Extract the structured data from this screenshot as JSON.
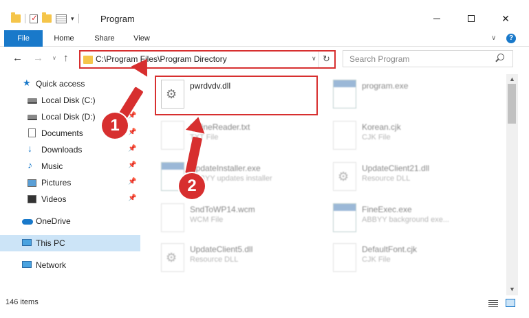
{
  "window": {
    "title": "Program",
    "controls": {
      "minimize": "minimize",
      "maximize": "maximize",
      "close": "close"
    }
  },
  "ribbon": {
    "tabs": [
      "File",
      "Home",
      "Share",
      "View"
    ],
    "help": "?"
  },
  "nav": {
    "address": "C:\\Program Files\\Program Directory",
    "search_placeholder": "Search Program"
  },
  "sidebar": {
    "items": [
      {
        "label": "Quick access",
        "icon": "star-icon",
        "pinned": false
      },
      {
        "label": "Local Disk (C:)",
        "icon": "drive-icon",
        "pinned": true
      },
      {
        "label": "Local Disk (D:)",
        "icon": "drive-icon",
        "pinned": true
      },
      {
        "label": "Documents",
        "icon": "documents-icon",
        "pinned": true
      },
      {
        "label": "Downloads",
        "icon": "download-icon",
        "pinned": true
      },
      {
        "label": "Music",
        "icon": "music-icon",
        "pinned": true
      },
      {
        "label": "Pictures",
        "icon": "pictures-icon",
        "pinned": true
      },
      {
        "label": "Videos",
        "icon": "videos-icon",
        "pinned": true
      },
      {
        "label": "OneDrive",
        "icon": "cloud-icon",
        "pinned": false
      },
      {
        "label": "This PC",
        "icon": "computer-icon",
        "pinned": false,
        "selected": true
      },
      {
        "label": "Network",
        "icon": "network-icon",
        "pinned": false
      }
    ]
  },
  "files": [
    {
      "name": "pwrdvdv.dll",
      "type": "",
      "icon": "dll-file-icon"
    },
    {
      "name": "program.exe",
      "type": "",
      "icon": "app-file-icon"
    },
    {
      "name": "fp.fineReader.txt",
      "type": "TXT File",
      "icon": "text-file-icon"
    },
    {
      "name": "Korean.cjk",
      "type": "CJK File",
      "icon": "generic-file-icon"
    },
    {
      "name": "UpdateInstaller.exe",
      "type": "ABBYY updates installer",
      "icon": "app-file-icon"
    },
    {
      "name": "UpdateClient21.dll",
      "type": "Resource DLL",
      "icon": "dll-file-icon"
    },
    {
      "name": "SndToWP14.wcm",
      "type": "WCM File",
      "icon": "generic-file-icon"
    },
    {
      "name": "FineExec.exe",
      "type": "ABBYY background exe...",
      "icon": "app-file-icon"
    },
    {
      "name": "UpdateClient5.dll",
      "type": "Resource DLL",
      "icon": "dll-file-icon"
    },
    {
      "name": "DefaultFont.cjk",
      "type": "CJK File",
      "icon": "generic-file-icon"
    }
  ],
  "status": {
    "item_count": "146 items"
  },
  "annotations": {
    "step1": "1",
    "step2": "2"
  },
  "colors": {
    "accent": "#1979ca",
    "highlight": "#d72f2f",
    "selected": "#cce4f7"
  }
}
